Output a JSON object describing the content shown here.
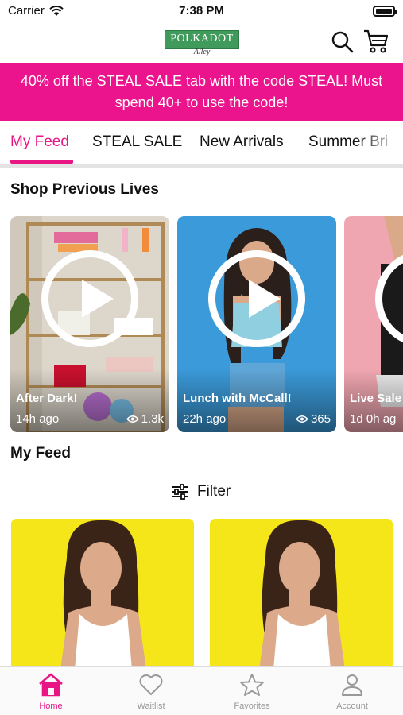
{
  "status_bar": {
    "carrier": "Carrier",
    "time": "7:38 PM"
  },
  "header": {
    "logo_text": "POLKADOT",
    "logo_sub": "Alley"
  },
  "promo": {
    "text": "40% off the STEAL SALE tab with the code STEAL! Must spend 40+ to use the code!"
  },
  "tabs": [
    "My Feed",
    "STEAL SALE",
    "New Arrivals",
    "Summer Bri"
  ],
  "sections": {
    "previous_lives": "Shop Previous Lives",
    "my_feed": "My Feed"
  },
  "lives": [
    {
      "title": "After Dark!",
      "ago": "14h ago",
      "views": "1.3k"
    },
    {
      "title": "Lunch with McCall!",
      "ago": "22h ago",
      "views": "365"
    },
    {
      "title": "Live Sale",
      "ago": "1d 0h ag"
    }
  ],
  "filter": {
    "label": "Filter"
  },
  "bottom_nav": [
    {
      "label": "Home",
      "icon": "home-icon",
      "active": true
    },
    {
      "label": "Waitlist",
      "icon": "heart-icon"
    },
    {
      "label": "Favorites",
      "icon": "star-icon"
    },
    {
      "label": "Account",
      "icon": "person-icon"
    }
  ],
  "colors": {
    "accent": "#e91585",
    "promo_bg": "#ec148c",
    "product_bg": "#f5e61a"
  }
}
